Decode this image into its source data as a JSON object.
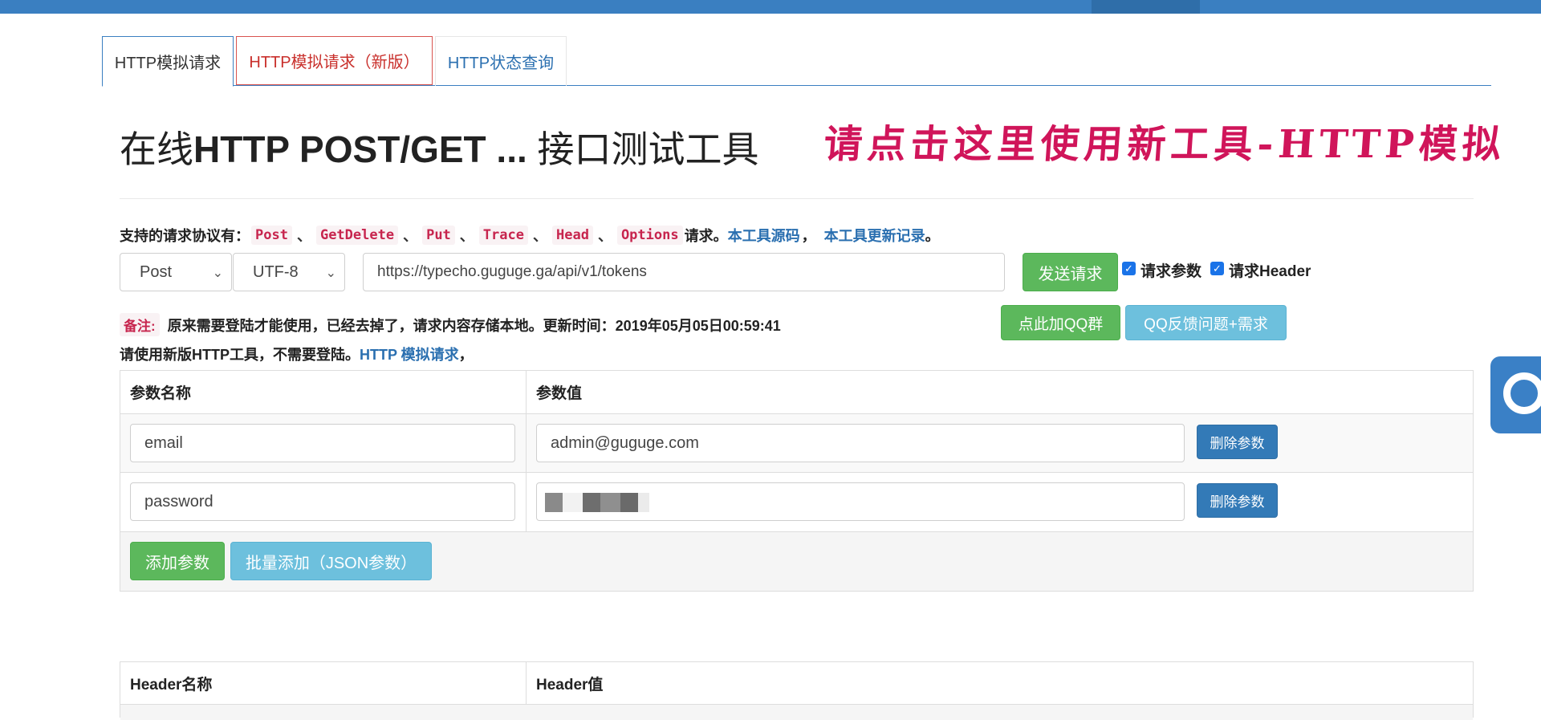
{
  "tabs": [
    {
      "label": "HTTP模拟请求"
    },
    {
      "label": "HTTP模拟请求（新版）"
    },
    {
      "label": "HTTP状态查询"
    }
  ],
  "page": {
    "title_prefix": "在线",
    "title_bold": "HTTP POST/GET ...",
    "title_suffix": " 接口测试工具",
    "promo_link": "请点击这里使用新工具-HTTP模拟"
  },
  "protocols": {
    "prefix": "支持的请求协议有：",
    "items": [
      "Post",
      "GetDelete",
      "Put",
      "Trace",
      "Head",
      "Options"
    ],
    "separator": "、",
    "suffix": "请求。",
    "source_link": "本工具源码",
    "comma": "，",
    "changelog_link": "本工具更新记录",
    "end": "。"
  },
  "request": {
    "method": "Post",
    "charset": "UTF-8",
    "url": "https://typecho.guguge.ga/api/v1/tokens",
    "send_label": "发送请求",
    "chk_params_label": "请求参数",
    "chk_header_label": "请求Header"
  },
  "note": {
    "tag": "备注:",
    "text": "原来需要登陆才能使用，已经去掉了，请求内容存储本地。更新时间：2019年05月05日00:59:41",
    "qq_group": "点此加QQ群",
    "qq_feedback": "QQ反馈问题+需求",
    "line2_prefix": "请使用新版HTTP工具，不需要登陆。",
    "line2_link": "HTTP 模拟请求",
    "line2_suffix": "，"
  },
  "params_table": {
    "col_name": "参数名称",
    "col_value": "参数值",
    "rows": [
      {
        "name": "email",
        "value": "admin@guguge.com",
        "delete": "删除参数"
      },
      {
        "name": "password",
        "value": "",
        "delete": "删除参数"
      }
    ],
    "add_label": "添加参数",
    "batch_label": "批量添加（JSON参数）"
  },
  "headers_table": {
    "col_name": "Header名称",
    "col_value": "Header值"
  },
  "colors": {
    "brand_blue": "#3a7fc1",
    "green": "#5cb85c",
    "info": "#6dc0dd",
    "primary": "#337ab7",
    "code_red": "#c7254e",
    "promo": "#d0155a"
  },
  "icons": {
    "side_tool": "search-icon",
    "select_caret": "chevron-down-icon",
    "checkbox": "check-icon"
  }
}
